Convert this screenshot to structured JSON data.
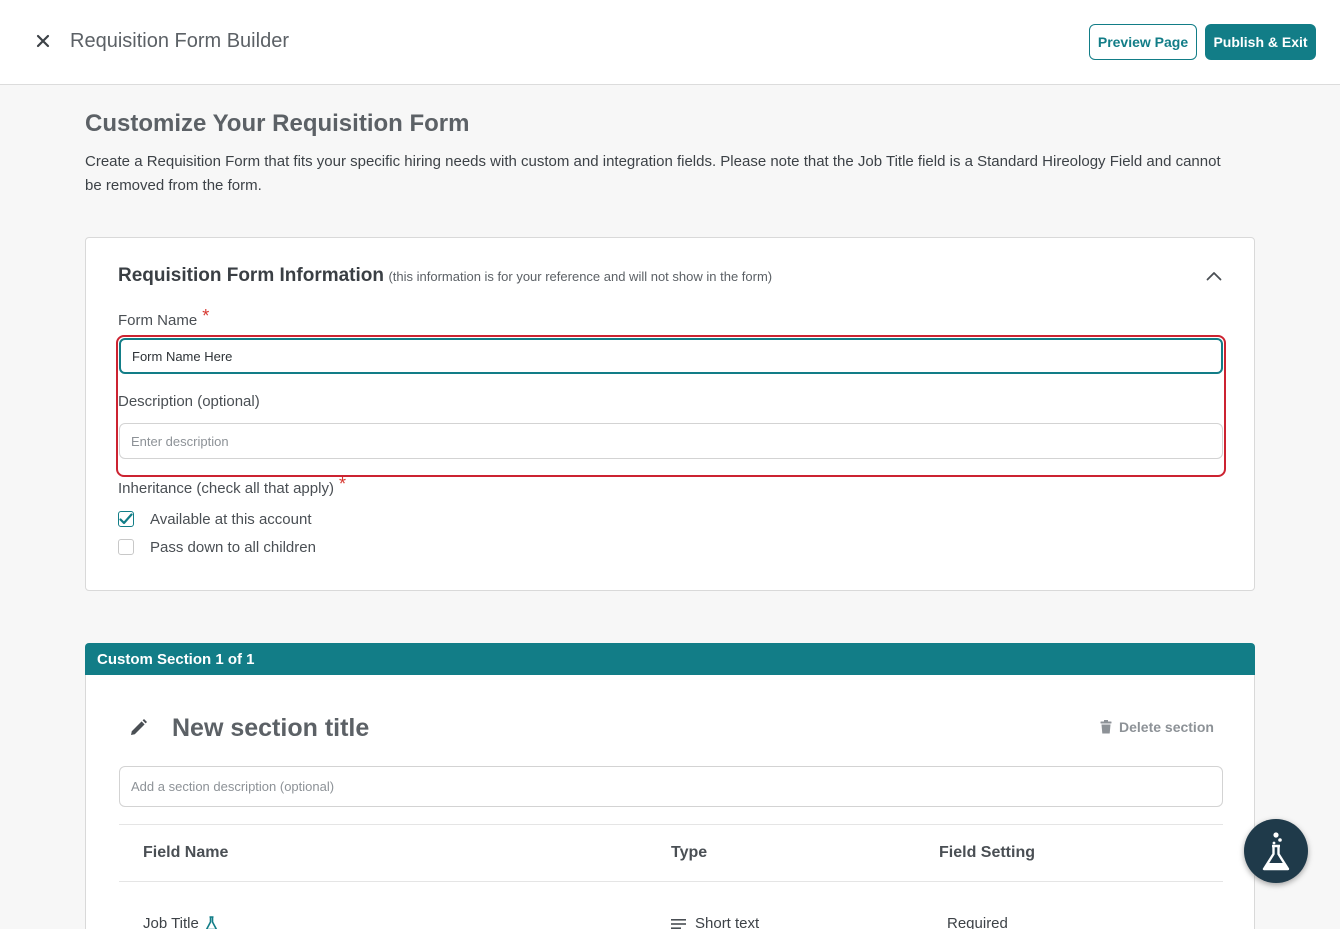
{
  "header": {
    "close_icon": "close-icon",
    "title": "Requisition Form Builder",
    "preview_label": "Preview Page",
    "publish_label": "Publish & Exit"
  },
  "page": {
    "title": "Customize Your Requisition Form",
    "description": "Create a Requisition Form that fits your specific hiring needs with custom and integration fields. Please note that the Job Title field is a Standard Hireology Field and cannot be removed from the form."
  },
  "info_card": {
    "heading": "Requisition Form Information",
    "note": "(this information is for your reference and will not show in the form)",
    "form_name_label": "Form Name",
    "required_mark": "*",
    "form_name_value": "Form Name Here",
    "description_label": "Description (optional)",
    "description_placeholder": "Enter description",
    "inheritance_label": "Inheritance (check all that apply)",
    "options": [
      {
        "label": "Available at this account",
        "checked": true
      },
      {
        "label": "Pass down to all children",
        "checked": false
      }
    ]
  },
  "custom_section": {
    "header": "Custom Section 1 of 1",
    "title": "New section title",
    "delete_label": "Delete section",
    "description_placeholder": "Add a section description (optional)",
    "columns": [
      "Field Name",
      "Type",
      "Field Setting"
    ],
    "rows": [
      {
        "field_name": "Job Title",
        "type": "Short text",
        "setting": "Required"
      }
    ]
  },
  "colors": {
    "accent": "#127d87",
    "highlight": "#cc2331",
    "required": "#d6372f"
  }
}
